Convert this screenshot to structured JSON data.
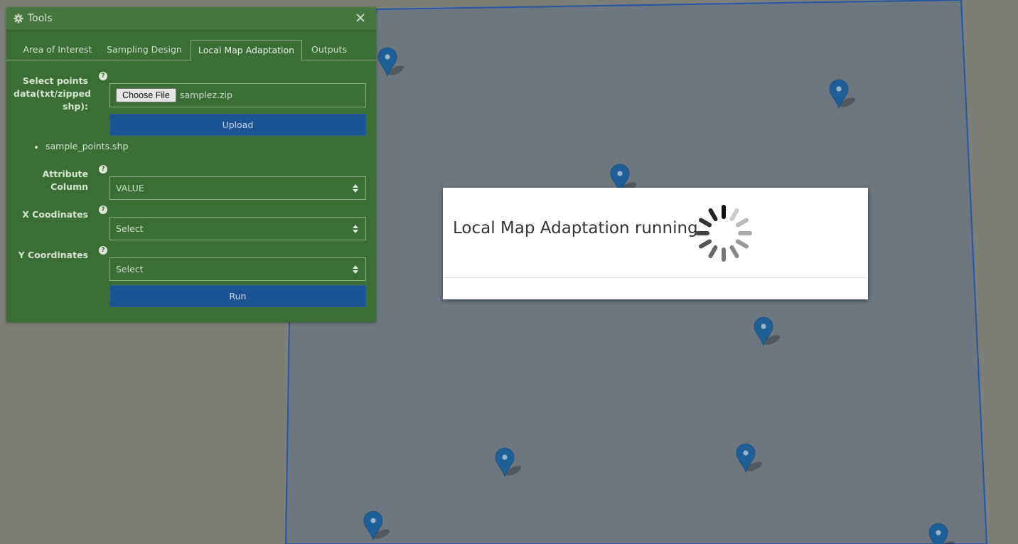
{
  "panel": {
    "title": "Tools",
    "close_icon": "close-icon",
    "gear_icon": "gear-icon"
  },
  "tabs": [
    {
      "label": "Area of Interest",
      "active": false
    },
    {
      "label": "Sampling Design",
      "active": false
    },
    {
      "label": "Local Map Adaptation",
      "active": true
    },
    {
      "label": "Outputs",
      "active": false
    }
  ],
  "form": {
    "points_label": "Select points data(txt/zipped shp):",
    "choose_file_label": "Choose File",
    "selected_file": "samplez.zip",
    "upload_label": "Upload",
    "uploaded_files": [
      "sample_points.shp"
    ],
    "attribute_label": "Attribute Column",
    "attribute_value": "VALUE",
    "x_label": "X Coodinates",
    "x_value": "Select",
    "y_label": "Y Coordinates",
    "y_value": "Select",
    "run_label": "Run",
    "help_glyph": "?"
  },
  "modal": {
    "message": "Local Map Adaptation running",
    "spinner_icon": "loading-spinner-icon"
  },
  "colors": {
    "panel_bg": "#3a6e35",
    "button_blue": "#1c5393",
    "map_polygon_fill": "#6e7680",
    "map_polygon_stroke": "#2456a6",
    "marker": "#1f5f98"
  }
}
